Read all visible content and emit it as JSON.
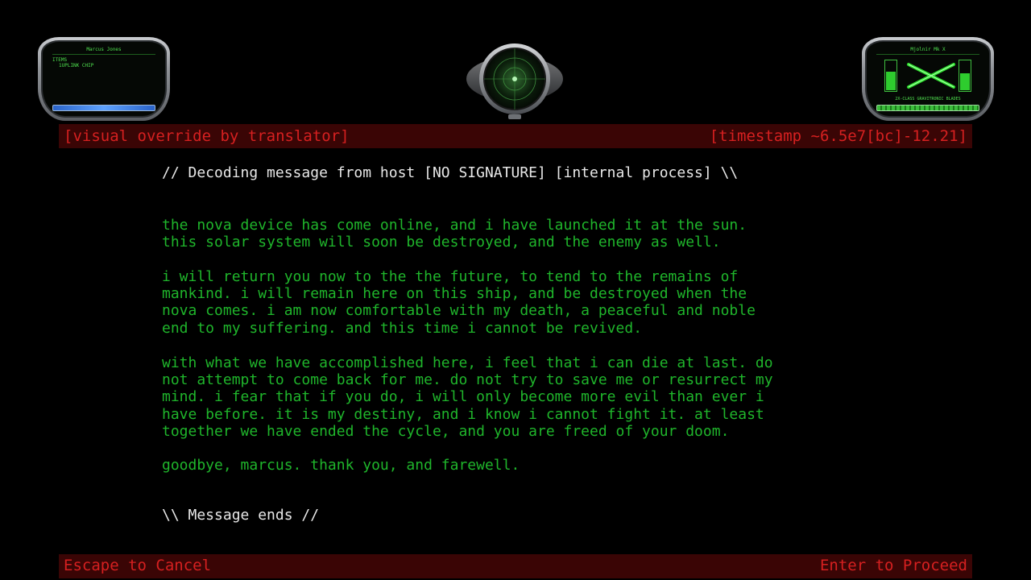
{
  "hud_left": {
    "player_name": "Marcus Jones",
    "items_label": "ITEMS",
    "items": [
      "1UPLINK CHIP"
    ]
  },
  "hud_right": {
    "weapon_title": "Mjolnir Mk X",
    "weapon_name": "2X-CLASS GRAVITRONIC BLADES",
    "left_meter_level": 0.6,
    "right_meter_level": 0.55
  },
  "header_bar": {
    "left_text": "[visual override by translator]",
    "right_text": "[timestamp ~6.5e7[bc]-12.21]"
  },
  "message": {
    "header": "// Decoding message from host [NO SIGNATURE] [internal process] \\\\",
    "paragraphs": [
      "the nova device has come online, and i have launched it at the sun.\nthis solar system will soon be destroyed, and the enemy as well.",
      "i will return you now to the the future, to tend to the remains of\nmankind. i will remain here on this ship, and be destroyed when the\nnova comes. i am now comfortable with my death, a peaceful and noble\nend to my suffering. and this time i cannot be revived.",
      "with what we have accomplished here, i feel that i can die at last. do\nnot attempt to come back for me. do not try to save me or resurrect my\nmind. i fear that if you do, i will only become more evil than ever i\nhave before. it is my destiny, and i know i cannot fight it. at least\ntogether we have ended the cycle, and you are freed of your doom.",
      "goodbye, marcus. thank you, and farewell."
    ],
    "footer": "\\\\ Message ends //"
  },
  "footer_bar": {
    "cancel_label": "Escape to Cancel",
    "proceed_label": "Enter to Proceed"
  },
  "colors": {
    "message_green": "#1fb52b",
    "bar_red": "#d62020",
    "bar_background": "#3a0505",
    "hud_green": "#4fe24f"
  },
  "icons": {
    "radar": "radar-icon",
    "weapon": "crossed-blades-icon"
  }
}
